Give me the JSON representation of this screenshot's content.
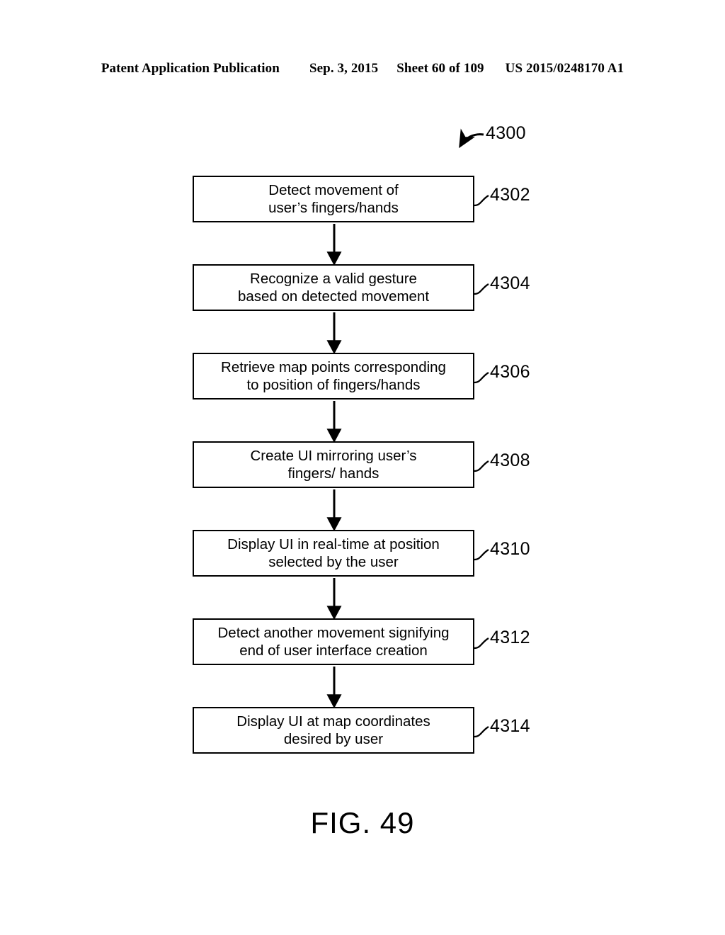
{
  "header": {
    "publication": "Patent Application Publication",
    "date": "Sep. 3, 2015",
    "sheet": "Sheet 60 of 109",
    "patent_number": "US 2015/0248170 A1"
  },
  "figure": {
    "caption": "FIG. 49",
    "flow_ref": "4300",
    "ink_color": "#000000",
    "background_color": "#ffffff"
  },
  "flowchart": {
    "type": "flowchart",
    "orientation": "vertical",
    "connector": "arrow-down",
    "nodes": [
      {
        "ref": "4302",
        "text": "Detect movement of\nuser’s fingers/hands"
      },
      {
        "ref": "4304",
        "text": "Recognize a valid gesture\nbased on detected movement"
      },
      {
        "ref": "4306",
        "text": "Retrieve map points corresponding\nto position of fingers/hands"
      },
      {
        "ref": "4308",
        "text": "Create UI mirroring user’s\nfingers/ hands"
      },
      {
        "ref": "4310",
        "text": "Display UI in real-time at position\nselected by the user"
      },
      {
        "ref": "4312",
        "text": "Detect another movement signifying\nend of user interface creation"
      },
      {
        "ref": "4314",
        "text": "Display UI at map coordinates\ndesired by user"
      }
    ]
  }
}
